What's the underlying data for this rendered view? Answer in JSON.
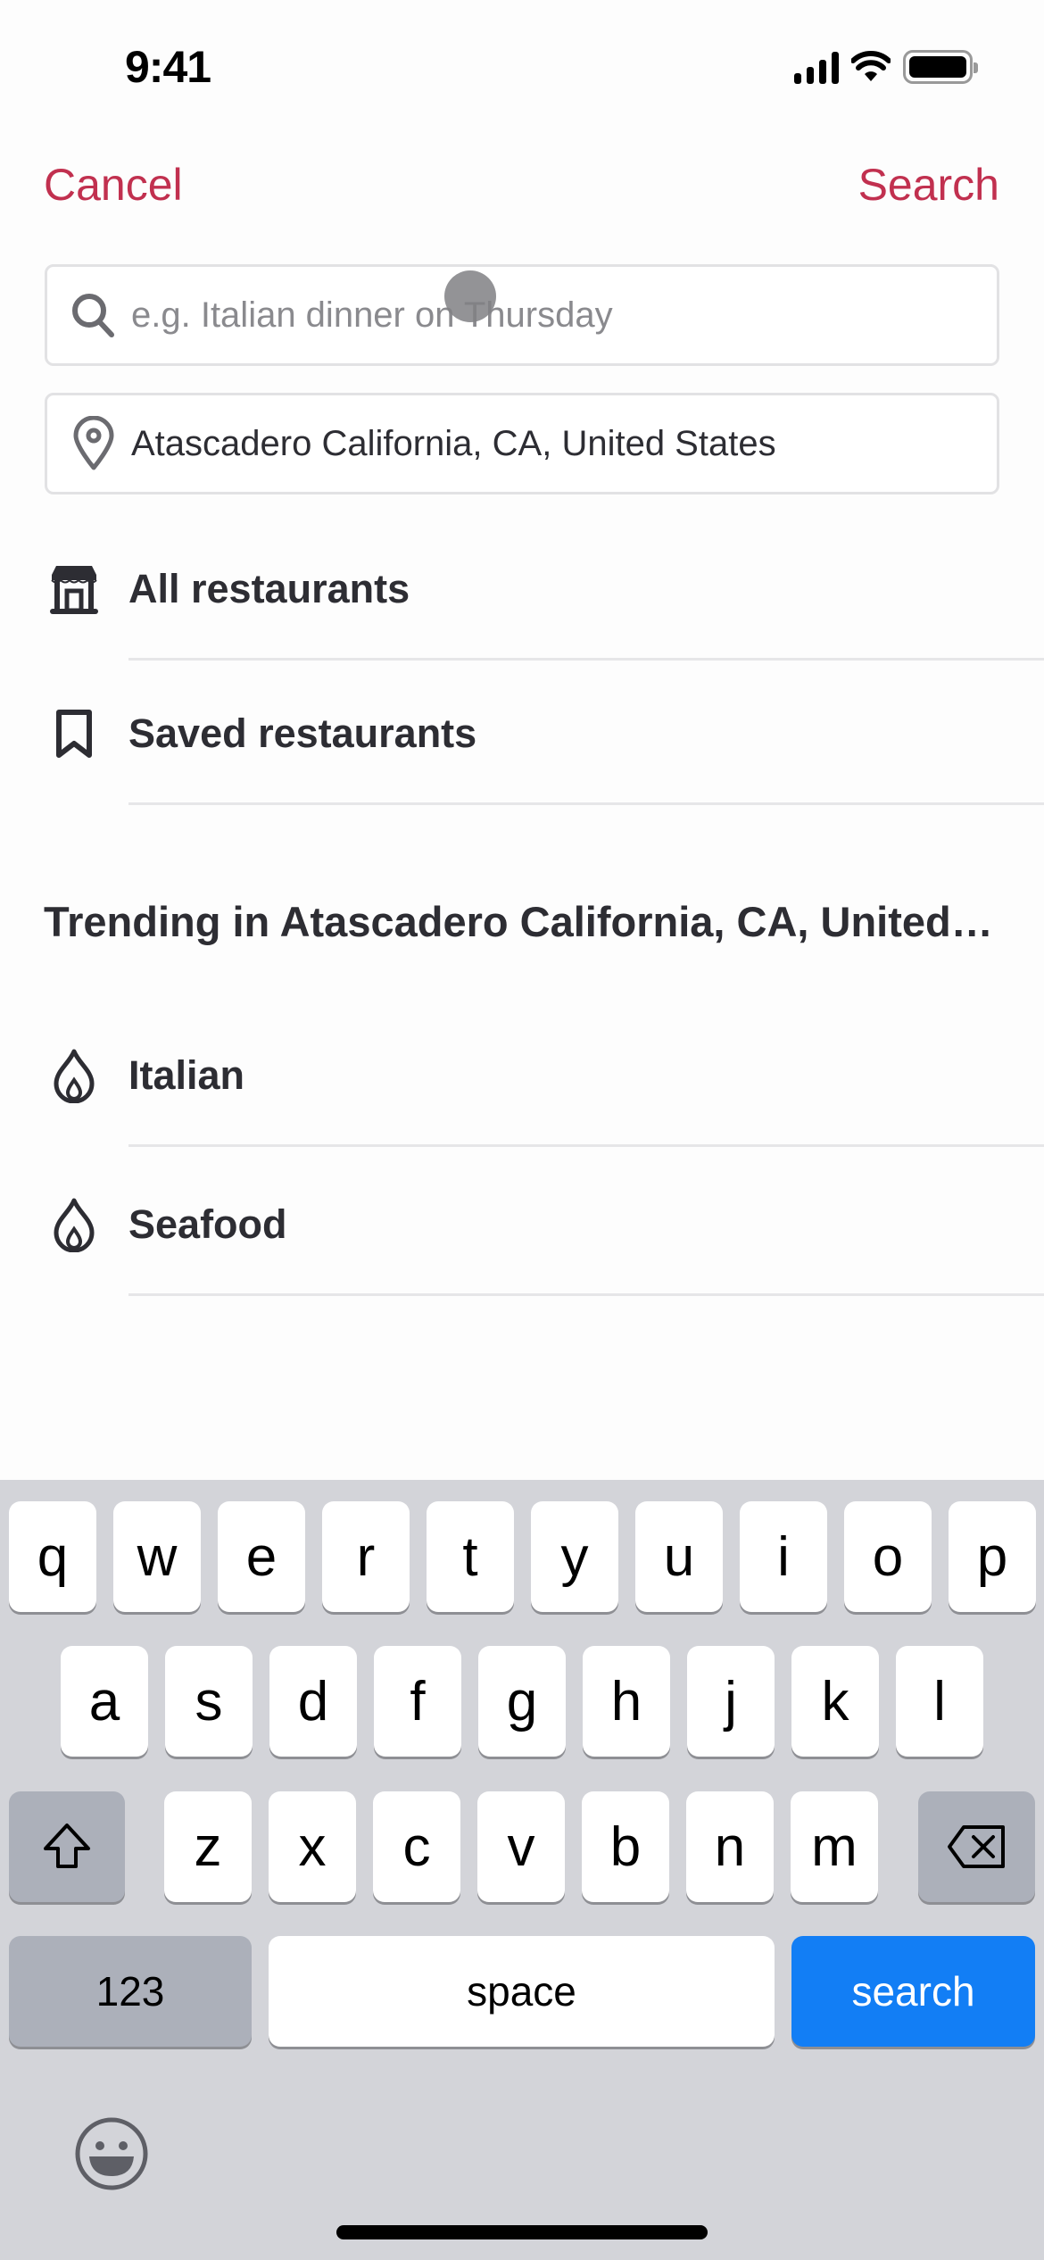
{
  "status_bar": {
    "time": "9:41",
    "icons": [
      "cellular-signal-icon",
      "wifi-icon",
      "battery-icon"
    ]
  },
  "nav": {
    "cancel_label": "Cancel",
    "search_label": "Search",
    "accent_color": "#c1304f"
  },
  "search_field": {
    "placeholder": "e.g. Italian dinner on Thursday",
    "value": "",
    "icon": "search-icon"
  },
  "location_field": {
    "value": "Atascadero California, CA, United States",
    "icon": "location-pin-icon"
  },
  "shortcuts": [
    {
      "label": "All restaurants",
      "icon": "storefront-icon"
    },
    {
      "label": "Saved restaurants",
      "icon": "bookmark-icon"
    }
  ],
  "trending": {
    "title": "Trending in Atascadero California, CA, United States",
    "items": [
      {
        "label": "Italian",
        "icon": "flame-icon"
      },
      {
        "label": "Seafood",
        "icon": "flame-icon"
      }
    ]
  },
  "keyboard": {
    "row1": [
      "q",
      "w",
      "e",
      "r",
      "t",
      "y",
      "u",
      "i",
      "o",
      "p"
    ],
    "row2": [
      "a",
      "s",
      "d",
      "f",
      "g",
      "h",
      "j",
      "k",
      "l"
    ],
    "row3": [
      "z",
      "x",
      "c",
      "v",
      "b",
      "n",
      "m"
    ],
    "numbers_label": "123",
    "space_label": "space",
    "return_label": "search",
    "return_color": "#127ef5"
  }
}
